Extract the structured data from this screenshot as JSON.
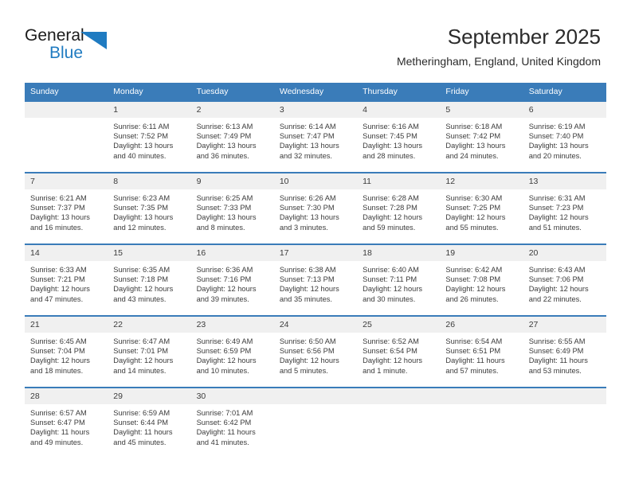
{
  "brand": {
    "name_part1": "General",
    "name_part2": "Blue",
    "mark": "triangle-logo",
    "color_primary": "#1f7bc1",
    "color_text": "#1b1b1b"
  },
  "header": {
    "title": "September 2025",
    "subtitle": "Metheringham, England, United Kingdom"
  },
  "theme": {
    "header_bg": "#3a7cb9",
    "header_text": "#ffffff",
    "daynum_bg": "#f0f0f0",
    "body_text": "#3b3b3b"
  },
  "weekday_headers": [
    "Sunday",
    "Monday",
    "Tuesday",
    "Wednesday",
    "Thursday",
    "Friday",
    "Saturday"
  ],
  "labels": {
    "sunrise_prefix": "Sunrise: ",
    "sunset_prefix": "Sunset: ",
    "daylight_prefix": "Daylight: "
  },
  "weeks": [
    [
      {
        "day": "",
        "empty": true,
        "sunrise": "",
        "sunset": "",
        "daylight_line1": "",
        "daylight_line2": ""
      },
      {
        "day": "1",
        "empty": false,
        "sunrise": "Sunrise: 6:11 AM",
        "sunset": "Sunset: 7:52 PM",
        "daylight_line1": "Daylight: 13 hours",
        "daylight_line2": "and 40 minutes."
      },
      {
        "day": "2",
        "empty": false,
        "sunrise": "Sunrise: 6:13 AM",
        "sunset": "Sunset: 7:49 PM",
        "daylight_line1": "Daylight: 13 hours",
        "daylight_line2": "and 36 minutes."
      },
      {
        "day": "3",
        "empty": false,
        "sunrise": "Sunrise: 6:14 AM",
        "sunset": "Sunset: 7:47 PM",
        "daylight_line1": "Daylight: 13 hours",
        "daylight_line2": "and 32 minutes."
      },
      {
        "day": "4",
        "empty": false,
        "sunrise": "Sunrise: 6:16 AM",
        "sunset": "Sunset: 7:45 PM",
        "daylight_line1": "Daylight: 13 hours",
        "daylight_line2": "and 28 minutes."
      },
      {
        "day": "5",
        "empty": false,
        "sunrise": "Sunrise: 6:18 AM",
        "sunset": "Sunset: 7:42 PM",
        "daylight_line1": "Daylight: 13 hours",
        "daylight_line2": "and 24 minutes."
      },
      {
        "day": "6",
        "empty": false,
        "sunrise": "Sunrise: 6:19 AM",
        "sunset": "Sunset: 7:40 PM",
        "daylight_line1": "Daylight: 13 hours",
        "daylight_line2": "and 20 minutes."
      }
    ],
    [
      {
        "day": "7",
        "empty": false,
        "sunrise": "Sunrise: 6:21 AM",
        "sunset": "Sunset: 7:37 PM",
        "daylight_line1": "Daylight: 13 hours",
        "daylight_line2": "and 16 minutes."
      },
      {
        "day": "8",
        "empty": false,
        "sunrise": "Sunrise: 6:23 AM",
        "sunset": "Sunset: 7:35 PM",
        "daylight_line1": "Daylight: 13 hours",
        "daylight_line2": "and 12 minutes."
      },
      {
        "day": "9",
        "empty": false,
        "sunrise": "Sunrise: 6:25 AM",
        "sunset": "Sunset: 7:33 PM",
        "daylight_line1": "Daylight: 13 hours",
        "daylight_line2": "and 8 minutes."
      },
      {
        "day": "10",
        "empty": false,
        "sunrise": "Sunrise: 6:26 AM",
        "sunset": "Sunset: 7:30 PM",
        "daylight_line1": "Daylight: 13 hours",
        "daylight_line2": "and 3 minutes."
      },
      {
        "day": "11",
        "empty": false,
        "sunrise": "Sunrise: 6:28 AM",
        "sunset": "Sunset: 7:28 PM",
        "daylight_line1": "Daylight: 12 hours",
        "daylight_line2": "and 59 minutes."
      },
      {
        "day": "12",
        "empty": false,
        "sunrise": "Sunrise: 6:30 AM",
        "sunset": "Sunset: 7:25 PM",
        "daylight_line1": "Daylight: 12 hours",
        "daylight_line2": "and 55 minutes."
      },
      {
        "day": "13",
        "empty": false,
        "sunrise": "Sunrise: 6:31 AM",
        "sunset": "Sunset: 7:23 PM",
        "daylight_line1": "Daylight: 12 hours",
        "daylight_line2": "and 51 minutes."
      }
    ],
    [
      {
        "day": "14",
        "empty": false,
        "sunrise": "Sunrise: 6:33 AM",
        "sunset": "Sunset: 7:21 PM",
        "daylight_line1": "Daylight: 12 hours",
        "daylight_line2": "and 47 minutes."
      },
      {
        "day": "15",
        "empty": false,
        "sunrise": "Sunrise: 6:35 AM",
        "sunset": "Sunset: 7:18 PM",
        "daylight_line1": "Daylight: 12 hours",
        "daylight_line2": "and 43 minutes."
      },
      {
        "day": "16",
        "empty": false,
        "sunrise": "Sunrise: 6:36 AM",
        "sunset": "Sunset: 7:16 PM",
        "daylight_line1": "Daylight: 12 hours",
        "daylight_line2": "and 39 minutes."
      },
      {
        "day": "17",
        "empty": false,
        "sunrise": "Sunrise: 6:38 AM",
        "sunset": "Sunset: 7:13 PM",
        "daylight_line1": "Daylight: 12 hours",
        "daylight_line2": "and 35 minutes."
      },
      {
        "day": "18",
        "empty": false,
        "sunrise": "Sunrise: 6:40 AM",
        "sunset": "Sunset: 7:11 PM",
        "daylight_line1": "Daylight: 12 hours",
        "daylight_line2": "and 30 minutes."
      },
      {
        "day": "19",
        "empty": false,
        "sunrise": "Sunrise: 6:42 AM",
        "sunset": "Sunset: 7:08 PM",
        "daylight_line1": "Daylight: 12 hours",
        "daylight_line2": "and 26 minutes."
      },
      {
        "day": "20",
        "empty": false,
        "sunrise": "Sunrise: 6:43 AM",
        "sunset": "Sunset: 7:06 PM",
        "daylight_line1": "Daylight: 12 hours",
        "daylight_line2": "and 22 minutes."
      }
    ],
    [
      {
        "day": "21",
        "empty": false,
        "sunrise": "Sunrise: 6:45 AM",
        "sunset": "Sunset: 7:04 PM",
        "daylight_line1": "Daylight: 12 hours",
        "daylight_line2": "and 18 minutes."
      },
      {
        "day": "22",
        "empty": false,
        "sunrise": "Sunrise: 6:47 AM",
        "sunset": "Sunset: 7:01 PM",
        "daylight_line1": "Daylight: 12 hours",
        "daylight_line2": "and 14 minutes."
      },
      {
        "day": "23",
        "empty": false,
        "sunrise": "Sunrise: 6:49 AM",
        "sunset": "Sunset: 6:59 PM",
        "daylight_line1": "Daylight: 12 hours",
        "daylight_line2": "and 10 minutes."
      },
      {
        "day": "24",
        "empty": false,
        "sunrise": "Sunrise: 6:50 AM",
        "sunset": "Sunset: 6:56 PM",
        "daylight_line1": "Daylight: 12 hours",
        "daylight_line2": "and 5 minutes."
      },
      {
        "day": "25",
        "empty": false,
        "sunrise": "Sunrise: 6:52 AM",
        "sunset": "Sunset: 6:54 PM",
        "daylight_line1": "Daylight: 12 hours",
        "daylight_line2": "and 1 minute."
      },
      {
        "day": "26",
        "empty": false,
        "sunrise": "Sunrise: 6:54 AM",
        "sunset": "Sunset: 6:51 PM",
        "daylight_line1": "Daylight: 11 hours",
        "daylight_line2": "and 57 minutes."
      },
      {
        "day": "27",
        "empty": false,
        "sunrise": "Sunrise: 6:55 AM",
        "sunset": "Sunset: 6:49 PM",
        "daylight_line1": "Daylight: 11 hours",
        "daylight_line2": "and 53 minutes."
      }
    ],
    [
      {
        "day": "28",
        "empty": false,
        "sunrise": "Sunrise: 6:57 AM",
        "sunset": "Sunset: 6:47 PM",
        "daylight_line1": "Daylight: 11 hours",
        "daylight_line2": "and 49 minutes."
      },
      {
        "day": "29",
        "empty": false,
        "sunrise": "Sunrise: 6:59 AM",
        "sunset": "Sunset: 6:44 PM",
        "daylight_line1": "Daylight: 11 hours",
        "daylight_line2": "and 45 minutes."
      },
      {
        "day": "30",
        "empty": false,
        "sunrise": "Sunrise: 7:01 AM",
        "sunset": "Sunset: 6:42 PM",
        "daylight_line1": "Daylight: 11 hours",
        "daylight_line2": "and 41 minutes."
      },
      {
        "day": "",
        "empty": true,
        "sunrise": "",
        "sunset": "",
        "daylight_line1": "",
        "daylight_line2": ""
      },
      {
        "day": "",
        "empty": true,
        "sunrise": "",
        "sunset": "",
        "daylight_line1": "",
        "daylight_line2": ""
      },
      {
        "day": "",
        "empty": true,
        "sunrise": "",
        "sunset": "",
        "daylight_line1": "",
        "daylight_line2": ""
      },
      {
        "day": "",
        "empty": true,
        "sunrise": "",
        "sunset": "",
        "daylight_line1": "",
        "daylight_line2": ""
      }
    ]
  ]
}
